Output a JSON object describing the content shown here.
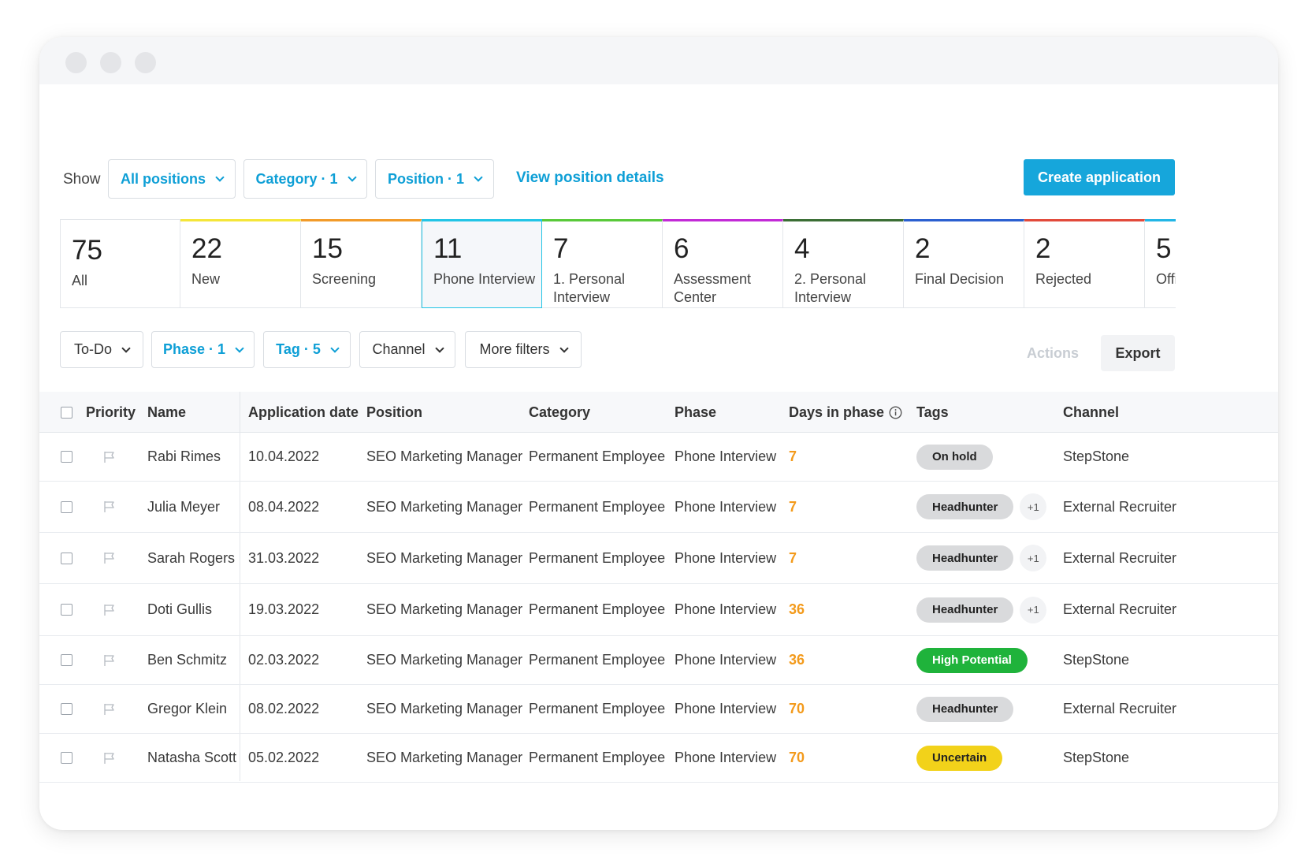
{
  "toolbar": {
    "show_label": "Show",
    "filters": [
      {
        "label": "All positions",
        "name": "all-positions-dropdown"
      },
      {
        "label": "Category · 1",
        "name": "category-dropdown"
      },
      {
        "label": "Position · 1",
        "name": "position-dropdown"
      }
    ],
    "view_details_link": "View position details",
    "create_button": "Create application"
  },
  "phases": [
    {
      "count": "75",
      "label": "All",
      "color": ""
    },
    {
      "count": "22",
      "label": "New",
      "color": "#f5e63a"
    },
    {
      "count": "15",
      "label": "Screening",
      "color": "#f29b2a"
    },
    {
      "count": "11",
      "label": "Phone Interview",
      "color": "#22c5e6"
    },
    {
      "count": "7",
      "label": "1. Personal Interview",
      "color": "#59c93a"
    },
    {
      "count": "6",
      "label": "Assessment Center",
      "color": "#c22ad6"
    },
    {
      "count": "4",
      "label": "2. Personal Interview",
      "color": "#3b6e35"
    },
    {
      "count": "2",
      "label": "Final Decision",
      "color": "#2b5fd0"
    },
    {
      "count": "2",
      "label": "Rejected",
      "color": "#e24a3b"
    },
    {
      "count": "5",
      "label": "Offi",
      "color": "#22b6e6"
    }
  ],
  "filters2": [
    {
      "label": "To-Do",
      "blue": false,
      "name": "todo-filter"
    },
    {
      "label": "Phase · 1",
      "blue": true,
      "name": "phase-filter"
    },
    {
      "label": "Tag · 5",
      "blue": true,
      "name": "tag-filter"
    },
    {
      "label": "Channel",
      "blue": false,
      "name": "channel-filter"
    },
    {
      "label": "More filters",
      "blue": false,
      "name": "more-filters"
    }
  ],
  "actions_label": "Actions",
  "export_label": "Export",
  "table": {
    "headers": {
      "priority": "Priority",
      "name": "Name",
      "date": "Application date",
      "position": "Position",
      "category": "Category",
      "phase": "Phase",
      "days": "Days in phase",
      "tags": "Tags",
      "channel": "Channel"
    },
    "rows": [
      {
        "name": "Rabi Rimes",
        "date": "10.04.2022",
        "position": "SEO Marketing Manager",
        "category": "Permanent Employee",
        "phase": "Phone Interview",
        "days": "7",
        "tag": "On hold",
        "tag_color": "#d9dadc",
        "extra": "",
        "channel": "StepStone"
      },
      {
        "name": "Julia Meyer",
        "date": "08.04.2022",
        "position": "SEO Marketing Manager",
        "category": "Permanent Employee",
        "phase": "Phone Interview",
        "days": "7",
        "tag": "Headhunter",
        "tag_color": "#d9dadc",
        "extra": "+1",
        "channel": "External Recruiter"
      },
      {
        "name": "Sarah Rogers",
        "date": "31.03.2022",
        "position": "SEO Marketing Manager",
        "category": "Permanent Employee",
        "phase": "Phone Interview",
        "days": "7",
        "tag": "Headhunter",
        "tag_color": "#d9dadc",
        "extra": "+1",
        "channel": "External Recruiter"
      },
      {
        "name": "Doti Gullis",
        "date": "19.03.2022",
        "position": "SEO Marketing Manager",
        "category": "Permanent Employee",
        "phase": "Phone Interview",
        "days": "36",
        "tag": "Headhunter",
        "tag_color": "#d9dadc",
        "extra": "+1",
        "channel": "External Recruiter"
      },
      {
        "name": "Ben Schmitz",
        "date": "02.03.2022",
        "position": "SEO Marketing Manager",
        "category": "Permanent Employee",
        "phase": "Phone Interview",
        "days": "36",
        "tag": "High Potential",
        "tag_color": "#1fb33b",
        "extra": "",
        "channel": "StepStone"
      },
      {
        "name": "Gregor Klein",
        "date": "08.02.2022",
        "position": "SEO Marketing Manager",
        "category": "Permanent Employee",
        "phase": "Phone Interview",
        "days": "70",
        "tag": "Headhunter",
        "tag_color": "#d9dadc",
        "extra": "",
        "channel": "External Recruiter"
      },
      {
        "name": "Natasha Scott",
        "date": "05.02.2022",
        "position": "SEO Marketing Manager",
        "category": "Permanent Employee",
        "phase": "Phone Interview",
        "days": "70",
        "tag": "Uncertain",
        "tag_color": "#f2d21a",
        "extra": "",
        "channel": "StepStone"
      }
    ]
  }
}
